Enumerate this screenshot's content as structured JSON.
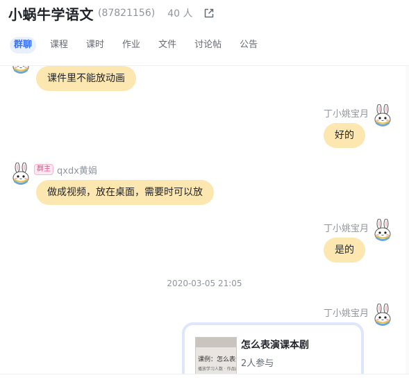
{
  "header": {
    "title": "小蜗牛学语文",
    "group_id": "(87821156)",
    "member_count": "40 人",
    "open_icon": "external-link-icon"
  },
  "tabs": [
    {
      "label": "群聊",
      "active": true
    },
    {
      "label": "课程",
      "active": false
    },
    {
      "label": "课时",
      "active": false
    },
    {
      "label": "作业",
      "active": false
    },
    {
      "label": "文件",
      "active": false
    },
    {
      "label": "讨论帖",
      "active": false
    },
    {
      "label": "公告",
      "active": false
    }
  ],
  "messages": [
    {
      "text": "课件里不能放动画",
      "side": "left"
    },
    {
      "sender": "丁小姚宝月",
      "text": "好的",
      "side": "right"
    },
    {
      "sender": "qxdx黄娟",
      "badge": "群主",
      "text": "做成视频，放在桌面，需要时可以放",
      "side": "left"
    },
    {
      "sender": "丁小姚宝月",
      "text": "是的",
      "side": "right"
    }
  ],
  "timestamp": "2020-03-05  21:05",
  "card_message": {
    "sender": "丁小姚宝月",
    "title": "怎么表演课本剧",
    "subtitle": "2人参与",
    "thumb_title": "课例：怎么表演课本剧",
    "thumb_caption": "播放学习人数 · 作品展示"
  },
  "colors": {
    "bubble": "#fde7b1",
    "active_tab_bg": "#e8effe",
    "active_tab_text": "#3370ff",
    "card_border": "#dde6fb",
    "badge_text": "#e0508a"
  },
  "avatar_icon": "bunny-avatar-icon"
}
